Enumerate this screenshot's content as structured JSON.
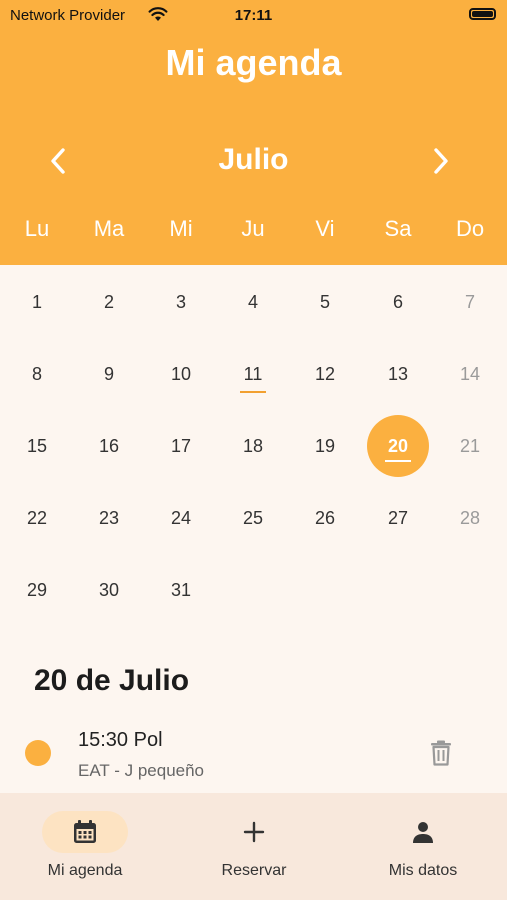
{
  "status_bar": {
    "carrier": "Network Provider",
    "time": "17:11"
  },
  "header": {
    "title": "Mi agenda",
    "month": "Julio"
  },
  "weekdays": [
    "Lu",
    "Ma",
    "Mi",
    "Ju",
    "Vi",
    "Sa",
    "Do"
  ],
  "calendar": {
    "today": "11",
    "selected": "20",
    "weeks": [
      [
        "1",
        "2",
        "3",
        "4",
        "5",
        "6",
        "7"
      ],
      [
        "8",
        "9",
        "10",
        "11",
        "12",
        "13",
        "14"
      ],
      [
        "15",
        "16",
        "17",
        "18",
        "19",
        "20",
        "21"
      ],
      [
        "22",
        "23",
        "24",
        "25",
        "26",
        "27",
        "28"
      ],
      [
        "29",
        "30",
        "31",
        "",
        "",
        "",
        ""
      ]
    ]
  },
  "selected_date_label": "20 de Julio",
  "events": [
    {
      "title": "15:30 Pol",
      "subtitle": "EAT - J pequeño",
      "color": "#fbb040"
    }
  ],
  "bottom_nav": [
    {
      "label": "Mi agenda",
      "icon": "calendar-icon",
      "active": true
    },
    {
      "label": "Reservar",
      "icon": "plus-icon",
      "active": false
    },
    {
      "label": "Mis datos",
      "icon": "person-icon",
      "active": false
    }
  ],
  "colors": {
    "accent": "#fbb040",
    "background": "#fdf6f0",
    "nav_background": "#f8e8dc",
    "pill": "#fde3c2"
  }
}
